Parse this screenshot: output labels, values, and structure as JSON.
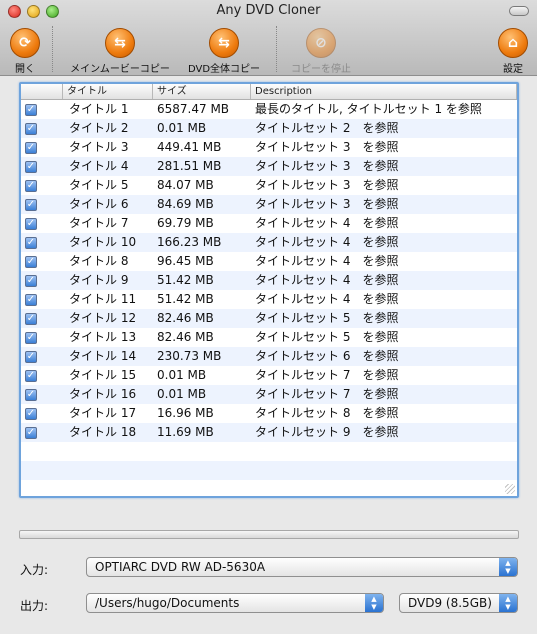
{
  "window": {
    "title": "Any DVD Cloner"
  },
  "toolbar": {
    "open_label": "開く",
    "main_movie_label": "メインムービーコピー",
    "full_dvd_label": "DVD全体コピー",
    "stop_label": "コピーを停止",
    "settings_label": "設定"
  },
  "table": {
    "headers": {
      "check": "",
      "title": "タイトル",
      "size": "サイズ",
      "desc": "Description"
    },
    "rows": [
      {
        "checked": true,
        "title": "タイトル 1",
        "size": "6587.47 MB",
        "desc": "最長のタイトル, タイトルセット 1 を参照"
      },
      {
        "checked": true,
        "title": "タイトル 2",
        "size": "0.01 MB",
        "desc": "タイトルセット 2　を参照"
      },
      {
        "checked": true,
        "title": "タイトル 3",
        "size": "449.41 MB",
        "desc": "タイトルセット 3　を参照"
      },
      {
        "checked": true,
        "title": "タイトル 4",
        "size": "281.51 MB",
        "desc": "タイトルセット 3　を参照"
      },
      {
        "checked": true,
        "title": "タイトル 5",
        "size": "84.07 MB",
        "desc": "タイトルセット 3　を参照"
      },
      {
        "checked": true,
        "title": "タイトル 6",
        "size": "84.69 MB",
        "desc": "タイトルセット 3　を参照"
      },
      {
        "checked": true,
        "title": "タイトル 7",
        "size": "69.79 MB",
        "desc": "タイトルセット 4　を参照"
      },
      {
        "checked": true,
        "title": "タイトル 10",
        "size": "166.23 MB",
        "desc": "タイトルセット 4　を参照"
      },
      {
        "checked": true,
        "title": "タイトル 8",
        "size": "96.45 MB",
        "desc": "タイトルセット 4　を参照"
      },
      {
        "checked": true,
        "title": "タイトル 9",
        "size": "51.42 MB",
        "desc": "タイトルセット 4　を参照"
      },
      {
        "checked": true,
        "title": "タイトル 11",
        "size": "51.42 MB",
        "desc": "タイトルセット 4　を参照"
      },
      {
        "checked": true,
        "title": "タイトル 12",
        "size": "82.46 MB",
        "desc": "タイトルセット 5　を参照"
      },
      {
        "checked": true,
        "title": "タイトル 13",
        "size": "82.46 MB",
        "desc": "タイトルセット 5　を参照"
      },
      {
        "checked": true,
        "title": "タイトル 14",
        "size": "230.73 MB",
        "desc": "タイトルセット 6　を参照"
      },
      {
        "checked": true,
        "title": "タイトル 15",
        "size": "0.01 MB",
        "desc": "タイトルセット 7　を参照"
      },
      {
        "checked": true,
        "title": "タイトル 16",
        "size": "0.01 MB",
        "desc": "タイトルセット 7　を参照"
      },
      {
        "checked": true,
        "title": "タイトル 17",
        "size": "16.96 MB",
        "desc": "タイトルセット 8　を参照"
      },
      {
        "checked": true,
        "title": "タイトル 18",
        "size": "11.69 MB",
        "desc": "タイトルセット 9　を参照"
      }
    ]
  },
  "form": {
    "input_label": "入力:",
    "input_value": "OPTIARC DVD RW AD-5630A",
    "output_label": "出力:",
    "output_value": "/Users/hugo/Documents",
    "disc_value": "DVD9 (8.5GB)"
  }
}
